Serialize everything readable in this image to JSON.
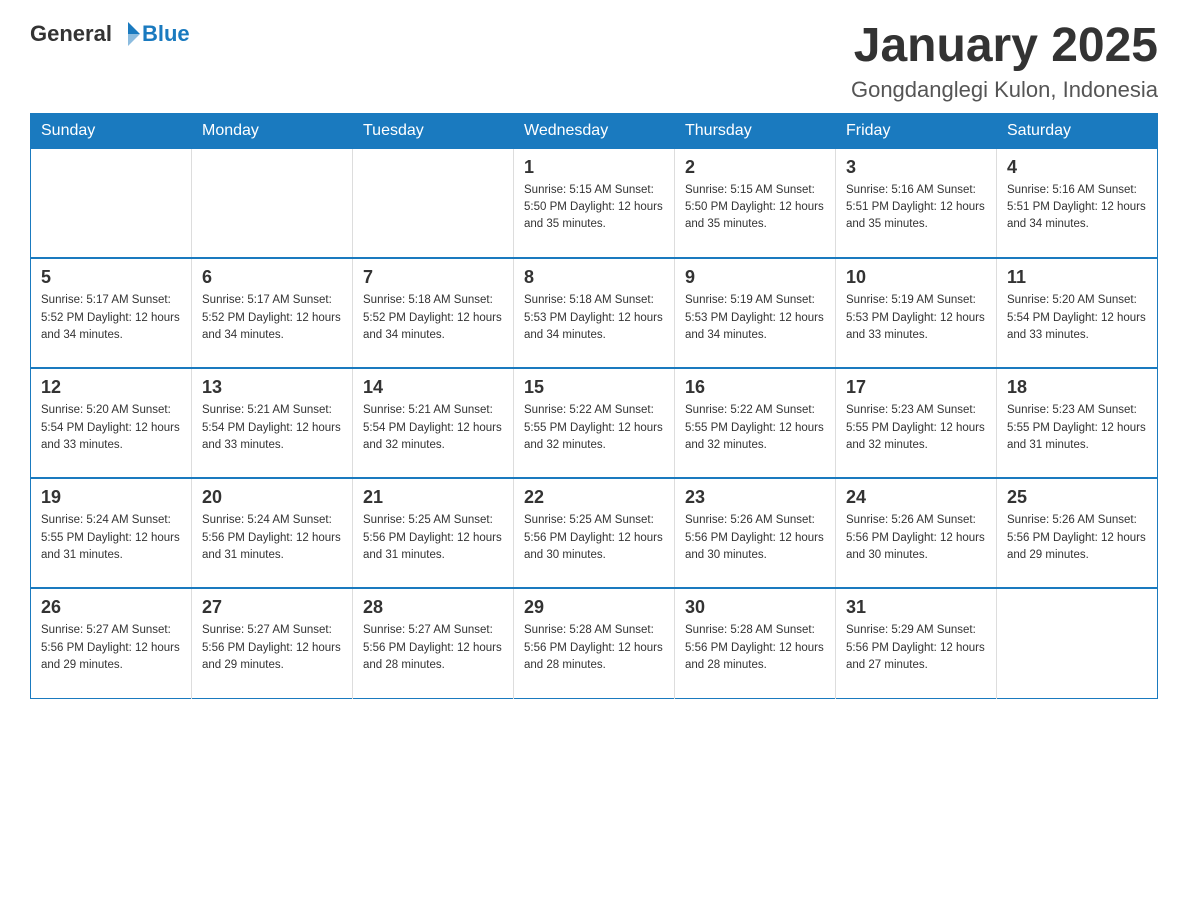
{
  "header": {
    "logo_general": "General",
    "logo_blue": "Blue",
    "month_title": "January 2025",
    "location": "Gongdanglegi Kulon, Indonesia"
  },
  "days_of_week": [
    "Sunday",
    "Monday",
    "Tuesday",
    "Wednesday",
    "Thursday",
    "Friday",
    "Saturday"
  ],
  "weeks": [
    [
      {
        "day": "",
        "info": ""
      },
      {
        "day": "",
        "info": ""
      },
      {
        "day": "",
        "info": ""
      },
      {
        "day": "1",
        "info": "Sunrise: 5:15 AM\nSunset: 5:50 PM\nDaylight: 12 hours\nand 35 minutes."
      },
      {
        "day": "2",
        "info": "Sunrise: 5:15 AM\nSunset: 5:50 PM\nDaylight: 12 hours\nand 35 minutes."
      },
      {
        "day": "3",
        "info": "Sunrise: 5:16 AM\nSunset: 5:51 PM\nDaylight: 12 hours\nand 35 minutes."
      },
      {
        "day": "4",
        "info": "Sunrise: 5:16 AM\nSunset: 5:51 PM\nDaylight: 12 hours\nand 34 minutes."
      }
    ],
    [
      {
        "day": "5",
        "info": "Sunrise: 5:17 AM\nSunset: 5:52 PM\nDaylight: 12 hours\nand 34 minutes."
      },
      {
        "day": "6",
        "info": "Sunrise: 5:17 AM\nSunset: 5:52 PM\nDaylight: 12 hours\nand 34 minutes."
      },
      {
        "day": "7",
        "info": "Sunrise: 5:18 AM\nSunset: 5:52 PM\nDaylight: 12 hours\nand 34 minutes."
      },
      {
        "day": "8",
        "info": "Sunrise: 5:18 AM\nSunset: 5:53 PM\nDaylight: 12 hours\nand 34 minutes."
      },
      {
        "day": "9",
        "info": "Sunrise: 5:19 AM\nSunset: 5:53 PM\nDaylight: 12 hours\nand 34 minutes."
      },
      {
        "day": "10",
        "info": "Sunrise: 5:19 AM\nSunset: 5:53 PM\nDaylight: 12 hours\nand 33 minutes."
      },
      {
        "day": "11",
        "info": "Sunrise: 5:20 AM\nSunset: 5:54 PM\nDaylight: 12 hours\nand 33 minutes."
      }
    ],
    [
      {
        "day": "12",
        "info": "Sunrise: 5:20 AM\nSunset: 5:54 PM\nDaylight: 12 hours\nand 33 minutes."
      },
      {
        "day": "13",
        "info": "Sunrise: 5:21 AM\nSunset: 5:54 PM\nDaylight: 12 hours\nand 33 minutes."
      },
      {
        "day": "14",
        "info": "Sunrise: 5:21 AM\nSunset: 5:54 PM\nDaylight: 12 hours\nand 32 minutes."
      },
      {
        "day": "15",
        "info": "Sunrise: 5:22 AM\nSunset: 5:55 PM\nDaylight: 12 hours\nand 32 minutes."
      },
      {
        "day": "16",
        "info": "Sunrise: 5:22 AM\nSunset: 5:55 PM\nDaylight: 12 hours\nand 32 minutes."
      },
      {
        "day": "17",
        "info": "Sunrise: 5:23 AM\nSunset: 5:55 PM\nDaylight: 12 hours\nand 32 minutes."
      },
      {
        "day": "18",
        "info": "Sunrise: 5:23 AM\nSunset: 5:55 PM\nDaylight: 12 hours\nand 31 minutes."
      }
    ],
    [
      {
        "day": "19",
        "info": "Sunrise: 5:24 AM\nSunset: 5:55 PM\nDaylight: 12 hours\nand 31 minutes."
      },
      {
        "day": "20",
        "info": "Sunrise: 5:24 AM\nSunset: 5:56 PM\nDaylight: 12 hours\nand 31 minutes."
      },
      {
        "day": "21",
        "info": "Sunrise: 5:25 AM\nSunset: 5:56 PM\nDaylight: 12 hours\nand 31 minutes."
      },
      {
        "day": "22",
        "info": "Sunrise: 5:25 AM\nSunset: 5:56 PM\nDaylight: 12 hours\nand 30 minutes."
      },
      {
        "day": "23",
        "info": "Sunrise: 5:26 AM\nSunset: 5:56 PM\nDaylight: 12 hours\nand 30 minutes."
      },
      {
        "day": "24",
        "info": "Sunrise: 5:26 AM\nSunset: 5:56 PM\nDaylight: 12 hours\nand 30 minutes."
      },
      {
        "day": "25",
        "info": "Sunrise: 5:26 AM\nSunset: 5:56 PM\nDaylight: 12 hours\nand 29 minutes."
      }
    ],
    [
      {
        "day": "26",
        "info": "Sunrise: 5:27 AM\nSunset: 5:56 PM\nDaylight: 12 hours\nand 29 minutes."
      },
      {
        "day": "27",
        "info": "Sunrise: 5:27 AM\nSunset: 5:56 PM\nDaylight: 12 hours\nand 29 minutes."
      },
      {
        "day": "28",
        "info": "Sunrise: 5:27 AM\nSunset: 5:56 PM\nDaylight: 12 hours\nand 28 minutes."
      },
      {
        "day": "29",
        "info": "Sunrise: 5:28 AM\nSunset: 5:56 PM\nDaylight: 12 hours\nand 28 minutes."
      },
      {
        "day": "30",
        "info": "Sunrise: 5:28 AM\nSunset: 5:56 PM\nDaylight: 12 hours\nand 28 minutes."
      },
      {
        "day": "31",
        "info": "Sunrise: 5:29 AM\nSunset: 5:56 PM\nDaylight: 12 hours\nand 27 minutes."
      },
      {
        "day": "",
        "info": ""
      }
    ]
  ]
}
